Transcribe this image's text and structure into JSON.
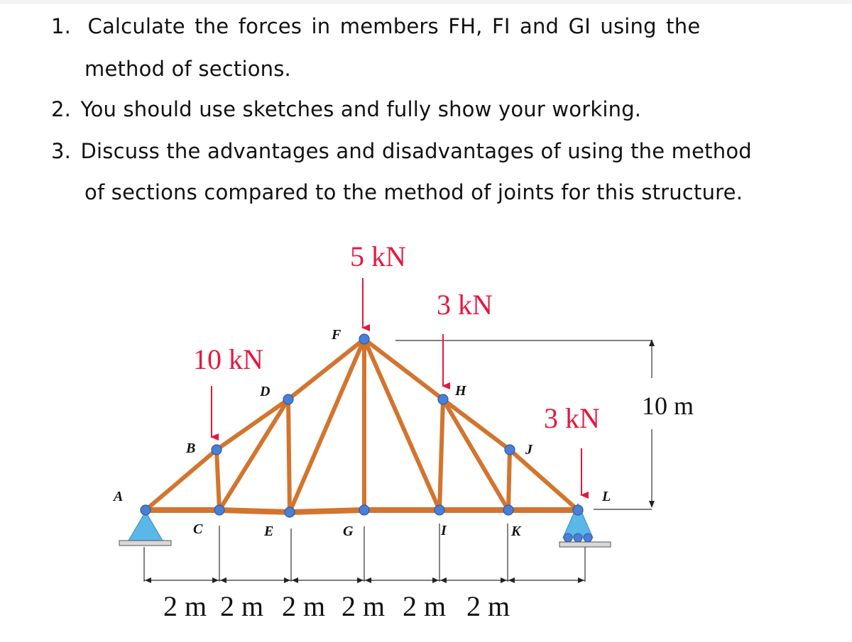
{
  "questions": [
    {
      "number": "1.",
      "lines": [
        "Calculate  the  forces  in  members  FH,  FI  and  GI  using  the",
        "method of sections."
      ]
    },
    {
      "number": "2.",
      "lines": [
        "You should use sketches and fully show your working."
      ]
    },
    {
      "number": "3.",
      "lines": [
        "Discuss the advantages and disadvantages of using the method",
        "of sections compared to the method of joints for this structure."
      ]
    }
  ],
  "truss": {
    "member_color": "#d2752f",
    "joint_color": "#4a7fd6",
    "support_color": "#59b8e8",
    "load_color": "#e8163c",
    "nodes": {
      "A": "A",
      "B": "B",
      "C": "C",
      "D": "D",
      "E": "E",
      "F": "F",
      "G": "G",
      "H": "H",
      "I": "I",
      "J": "J",
      "K": "K",
      "L": "L"
    },
    "members": [
      "AB",
      "AC",
      "BC",
      "BD",
      "CD",
      "CE",
      "DE",
      "DF",
      "EF",
      "EG",
      "FG",
      "FH",
      "FI",
      "GI",
      "HI",
      "HJ",
      "HK",
      "IK",
      "JK",
      "JL",
      "KL"
    ],
    "loads": [
      {
        "node": "B",
        "label": "10 kN",
        "value_kN": 10
      },
      {
        "node": "F",
        "label": "5 kN",
        "value_kN": 5
      },
      {
        "node": "H",
        "label": "3 kN",
        "value_kN": 3
      },
      {
        "node": "L",
        "label": "3 kN",
        "value_kN": 3
      }
    ],
    "supports": {
      "A": "pin",
      "L": "roller"
    },
    "height_label": "10 m",
    "height_m": 10,
    "spans": [
      {
        "label": "2 m",
        "value_m": 2
      },
      {
        "label": "2 m",
        "value_m": 2
      },
      {
        "label": "2 m",
        "value_m": 2
      },
      {
        "label": "2 m",
        "value_m": 2
      },
      {
        "label": "2 m",
        "value_m": 2
      },
      {
        "label": "2 m",
        "value_m": 2
      }
    ]
  }
}
